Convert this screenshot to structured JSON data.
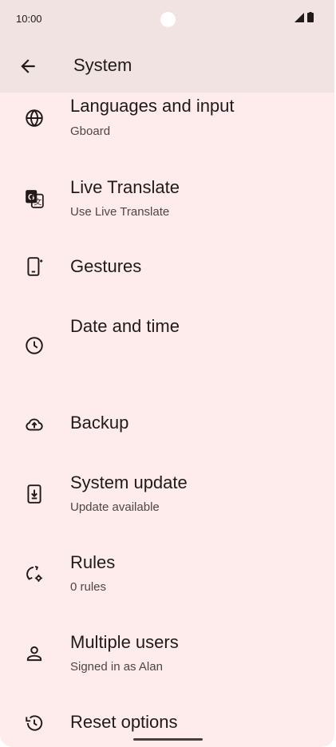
{
  "status_bar": {
    "time": "10:00"
  },
  "app_bar": {
    "title": "System"
  },
  "items": [
    {
      "label": "Languages and input",
      "sub": "Gboard",
      "icon": "globe-icon"
    },
    {
      "label": "Live Translate",
      "sub": "Use Live Translate",
      "icon": "translate-icon"
    },
    {
      "label": "Gestures",
      "sub": "",
      "icon": "gestures-phone-icon"
    },
    {
      "label": "Date and time",
      "sub": "",
      "icon": "clock-icon"
    },
    {
      "label": "Backup",
      "sub": "",
      "icon": "cloud-upload-icon"
    },
    {
      "label": "System update",
      "sub": "Update available",
      "icon": "system-update-icon"
    },
    {
      "label": "Rules",
      "sub": "0 rules",
      "icon": "rules-sync-icon"
    },
    {
      "label": "Multiple users",
      "sub": "Signed in as Alan",
      "icon": "person-icon"
    },
    {
      "label": "Reset options",
      "sub": "",
      "icon": "history-icon"
    }
  ]
}
